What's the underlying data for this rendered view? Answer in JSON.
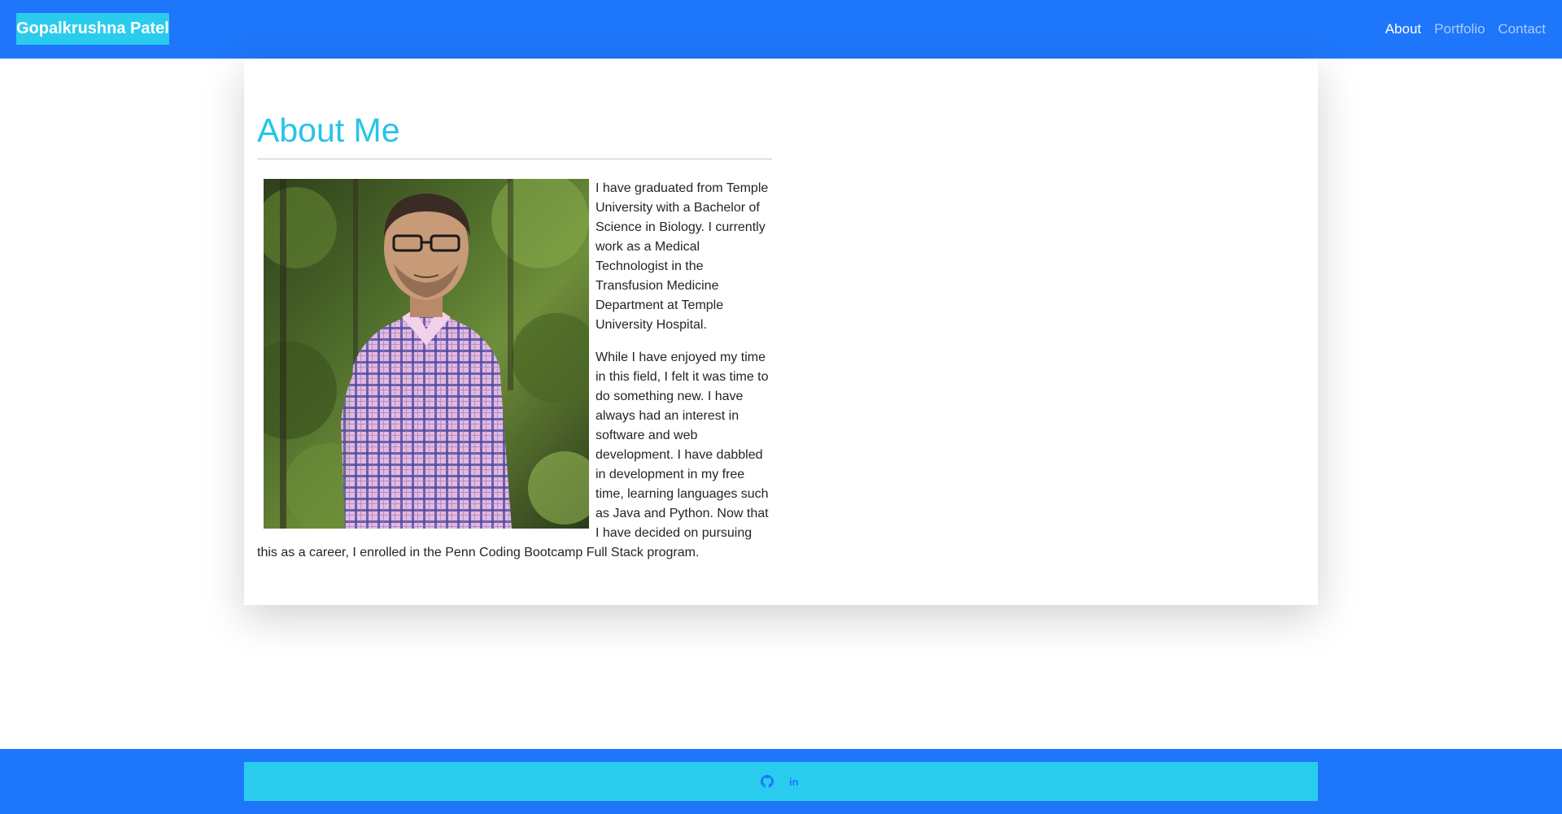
{
  "nav": {
    "brand": "Gopalkrushna Patel",
    "links": [
      {
        "label": "About",
        "active": true
      },
      {
        "label": "Portfolio",
        "active": false
      },
      {
        "label": "Contact",
        "active": false
      }
    ]
  },
  "about": {
    "heading": "About Me",
    "paragraphs": [
      "I have graduated from Temple University with a Bachelor of Science in Biology. I currently work as a Medical Technologist in the Transfusion Medicine Department at Temple University Hospital.",
      "While I have enjoyed my time in this field, I felt it was time to do something new. I have always had an interest in software and web development. I have dabbled in development in my free time, learning languages such as Java and Python. Now that I have decided on pursuing this as a career, I enrolled in the Penn Coding Bootcamp Full Stack program."
    ]
  },
  "footer": {
    "icons": [
      "github-icon",
      "linkedin-icon"
    ]
  },
  "colors": {
    "primary": "#1e76fa",
    "accent": "#2accee",
    "heading": "#26c4ea"
  }
}
